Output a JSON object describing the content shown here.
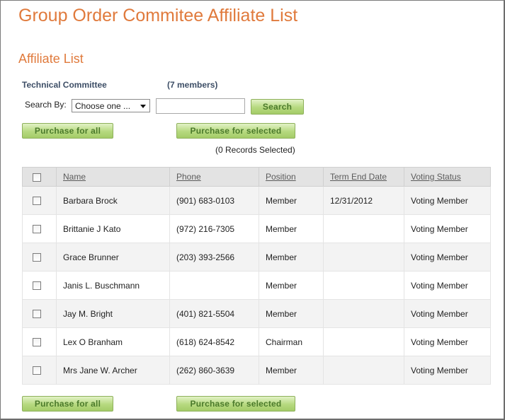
{
  "page": {
    "title": "Group Order Commitee Affiliate List",
    "section_title": "Affiliate List"
  },
  "committee": {
    "name": "Technical Committee",
    "member_count": "(7 members)"
  },
  "search": {
    "label": "Search By:",
    "select_value": "Choose one ...",
    "input_value": "",
    "button_label": "Search"
  },
  "actions": {
    "purchase_all_label": "Purchase for all",
    "purchase_selected_label": "Purchase for selected",
    "records_selected": "(0 Records Selected)"
  },
  "table": {
    "headers": [
      "Name",
      "Phone",
      "Position",
      "Term End Date",
      "Voting Status"
    ],
    "rows": [
      {
        "name": "Barbara Brock",
        "phone": "(901) 683-0103",
        "position": "Member",
        "term_end": "12/31/2012",
        "voting": "Voting Member"
      },
      {
        "name": "Brittanie J Kato",
        "phone": "(972) 216-7305",
        "position": "Member",
        "term_end": "",
        "voting": "Voting Member"
      },
      {
        "name": "Grace Brunner",
        "phone": "(203) 393-2566",
        "position": "Member",
        "term_end": "",
        "voting": "Voting Member"
      },
      {
        "name": "Janis L. Buschmann",
        "phone": "",
        "position": "Member",
        "term_end": "",
        "voting": "Voting Member"
      },
      {
        "name": "Jay M. Bright",
        "phone": "(401) 821-5504",
        "position": "Member",
        "term_end": "",
        "voting": "Voting Member"
      },
      {
        "name": "Lex O Branham",
        "phone": "(618) 624-8542",
        "position": "Chairman",
        "term_end": "",
        "voting": "Voting Member"
      },
      {
        "name": "Mrs Jane W. Archer",
        "phone": "(262) 860-3639",
        "position": "Member",
        "term_end": "",
        "voting": "Voting Member"
      }
    ]
  },
  "colors": {
    "title_orange": "#e07a3c",
    "button_green": "#b6d97f",
    "button_text": "#4b7a2b",
    "committee_text": "#3d4e66"
  }
}
